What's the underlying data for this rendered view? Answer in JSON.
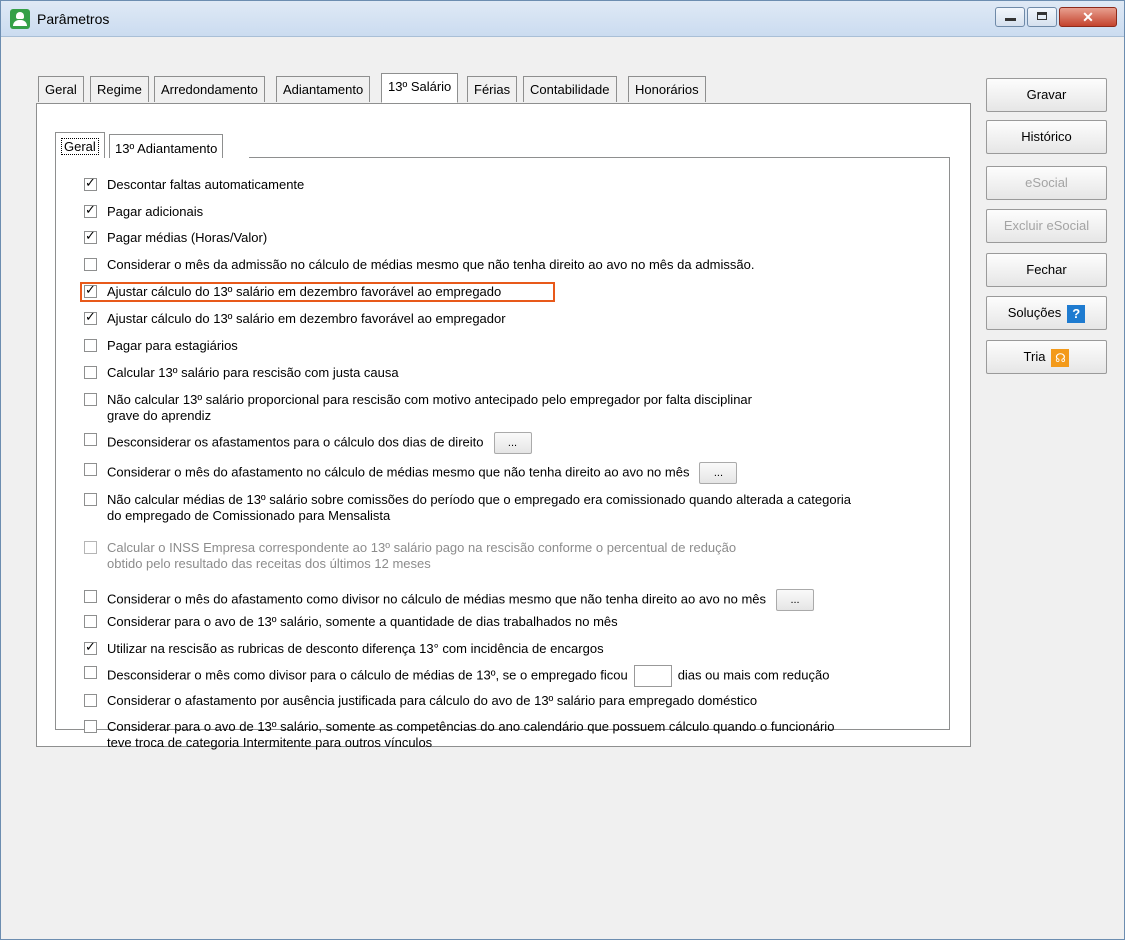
{
  "window": {
    "title": "Parâmetros"
  },
  "outer_tabs": [
    {
      "label": "Geral"
    },
    {
      "label": "Regime"
    },
    {
      "label": "Arredondamento"
    },
    {
      "label": "Adiantamento"
    },
    {
      "label": "13º Salário"
    },
    {
      "label": "Férias"
    },
    {
      "label": "Contabilidade"
    },
    {
      "label": "Honorários"
    }
  ],
  "inner_tabs": [
    {
      "label": "Geral"
    },
    {
      "label": "13º Adiantamento"
    }
  ],
  "options": [
    {
      "label": "Descontar faltas automaticamente",
      "checked": true
    },
    {
      "label": "Pagar adicionais",
      "checked": true
    },
    {
      "label": "Pagar médias (Horas/Valor)",
      "checked": true
    },
    {
      "label": "Considerar o mês da admissão no cálculo de médias mesmo que não tenha direito ao avo no mês da admissão.",
      "checked": false
    },
    {
      "label": "Ajustar cálculo do 13º salário em dezembro favorável ao empregado",
      "checked": true
    },
    {
      "label": "Ajustar cálculo do 13º salário em dezembro favorável ao empregador",
      "checked": true
    },
    {
      "label": "Pagar para estagiários",
      "checked": false
    },
    {
      "label": "Calcular 13º salário para rescisão com justa causa",
      "checked": false
    },
    {
      "label": "Não calcular 13º salário proporcional para rescisão com motivo antecipado pelo empregador por falta disciplinar",
      "label2": "grave do aprendiz",
      "checked": false
    },
    {
      "label": "Desconsiderar os afastamentos para o cálculo dos dias de direito",
      "checked": false,
      "button": "..."
    },
    {
      "label": "Considerar o mês do afastamento no cálculo de médias mesmo que não tenha direito ao avo no mês",
      "checked": false,
      "button": "..."
    },
    {
      "label": "Não calcular médias de 13º salário sobre comissões do período que o empregado era comissionado quando alterada a categoria",
      "label2": "do empregado de Comissionado para Mensalista",
      "checked": false
    },
    {
      "label": "Calcular o INSS Empresa correspondente ao 13º salário pago na rescisão conforme o percentual de redução",
      "label2": "obtido pelo resultado das receitas dos últimos 12 meses",
      "checked": false,
      "disabled": true
    },
    {
      "label": "Considerar o mês do afastamento como divisor no cálculo de médias mesmo que não tenha direito ao avo no mês",
      "checked": false,
      "button": "..."
    },
    {
      "label": "Considerar para o avo de 13º salário, somente a quantidade de dias trabalhados no mês",
      "checked": false
    },
    {
      "label": "Utilizar na rescisão as rubricas de desconto diferença 13° com incidência de encargos",
      "checked": true
    },
    {
      "label": "Desconsiderar o mês como divisor para o cálculo de médias de 13º, se o empregado ficou",
      "label_after": "dias ou mais com redução",
      "dias_value": "",
      "checked": false
    },
    {
      "label": "Considerar o afastamento por ausência justificada para cálculo do avo de 13º salário para empregado doméstico",
      "checked": false
    },
    {
      "label": "Considerar para o avo de 13º salário, somente as competências do ano calendário que possuem cálculo quando o funcionário",
      "label2": "teve troca de categoria Intermitente para outros vínculos",
      "checked": false
    }
  ],
  "side_buttons": {
    "gravar": "Gravar",
    "historico": "Histórico",
    "esocial": "eSocial",
    "excluir_esocial": "Excluir eSocial",
    "fechar": "Fechar",
    "solucoes": "Soluções",
    "tria": "Tria"
  },
  "icons": {
    "help": "question-icon",
    "tria": "tria-headset-icon"
  }
}
